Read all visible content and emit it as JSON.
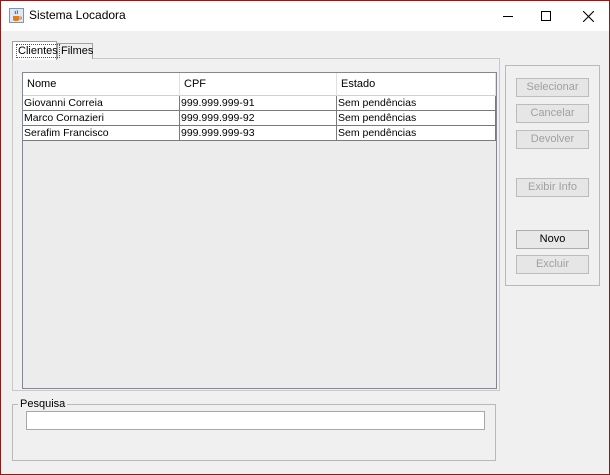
{
  "window": {
    "title": "Sistema Locadora",
    "icon": "java-cup-icon"
  },
  "tabs": [
    {
      "label": "Clientes",
      "selected": true
    },
    {
      "label": "Filmes",
      "selected": false
    }
  ],
  "table": {
    "columns": [
      "Nome",
      "CPF",
      "Estado"
    ],
    "rows": [
      [
        "Giovanni Correia",
        "999.999.999-91",
        "Sem pendências"
      ],
      [
        "Marco Cornazieri",
        "999.999.999-92",
        "Sem pendências"
      ],
      [
        "Serafim Francisco",
        "999.999.999-93",
        "Sem pendências"
      ]
    ]
  },
  "actions": {
    "selecionar": "Selecionar",
    "cancelar": "Cancelar",
    "devolver": "Devolver",
    "exibir_info": "Exibir Info",
    "novo": "Novo",
    "excluir": "Excluir"
  },
  "search": {
    "legend": "Pesquisa",
    "value": ""
  }
}
